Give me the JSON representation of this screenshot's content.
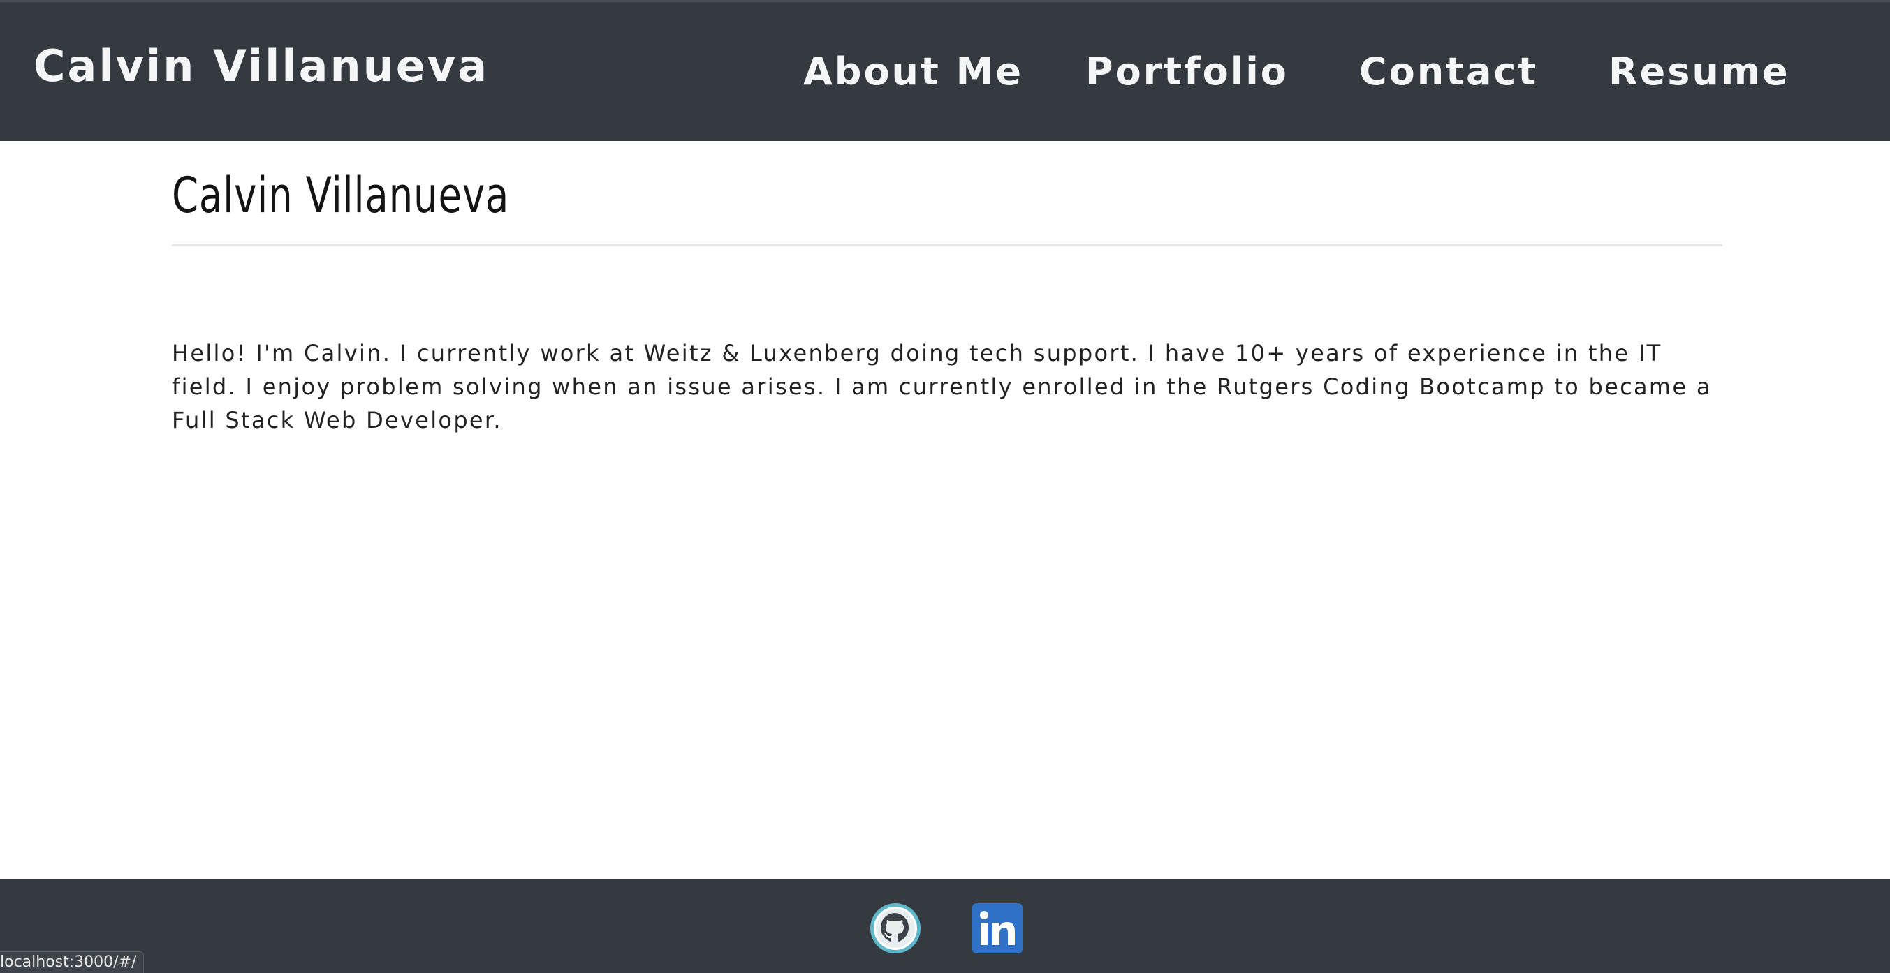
{
  "header": {
    "brand": "Calvin Villanueva",
    "nav": [
      {
        "label": "About Me"
      },
      {
        "label": "Portfolio"
      },
      {
        "label": "Contact"
      },
      {
        "label": "Resume"
      }
    ]
  },
  "main": {
    "title": "Calvin Villanueva",
    "bio": "Hello! I'm Calvin. I currently work at Weitz & Luxenberg doing tech support. I have 10+ years of experience in the IT field. I enjoy problem solving when an issue arises. I am currently enrolled in the Rutgers Coding Bootcamp to became a Full Stack Web Developer."
  },
  "footer": {
    "links": [
      {
        "icon": "github-icon"
      },
      {
        "icon": "linkedin-icon"
      }
    ]
  },
  "status": {
    "url": "localhost:3000/#/"
  },
  "colors": {
    "header_bg": "#343a40",
    "footer_bg": "#343a40",
    "nav_text": "#f4f5f7",
    "linkedin_blue": "#2e71c5",
    "github_ring": "#5fb8c9"
  }
}
